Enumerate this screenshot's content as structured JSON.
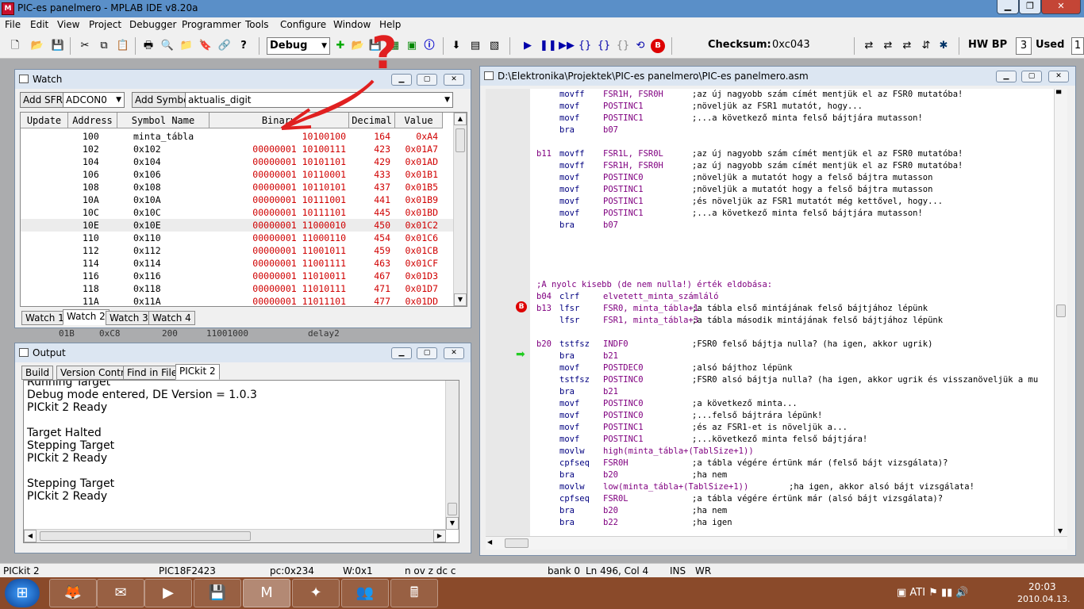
{
  "window": {
    "title": "PIC-es panelmero - MPLAB IDE v8.20a",
    "app_icon": "MPLAB IDE"
  },
  "menu": [
    "File",
    "Edit",
    "View",
    "Project",
    "Debugger",
    "Programmer",
    "Tools",
    "Configure",
    "Window",
    "Help"
  ],
  "toolbar": {
    "config": "Debug",
    "checksum_label": "Checksum:",
    "checksum_value": "0xc043",
    "hwbp_label": "HW BP",
    "hwbp_value": "3",
    "used_label": "Used",
    "used_value": "1"
  },
  "annotation": {
    "question_mark": "?"
  },
  "watch": {
    "title": "Watch",
    "add_sfr": "Add SFR",
    "sfr_value": "ADCON0",
    "add_symbol": "Add Symbol",
    "symbol_value": "aktualis_digit",
    "columns": [
      "Update",
      "Address",
      "Symbol Name",
      "Binary",
      "Decimal",
      "Value"
    ],
    "rows": [
      {
        "addr": "100",
        "sym": "minta_tábla",
        "bin": "10100100",
        "dec": "164",
        "val": "0xA4"
      },
      {
        "addr": "102",
        "sym": "0x102",
        "bin": "00000001 10100111",
        "dec": "423",
        "val": "0x01A7"
      },
      {
        "addr": "104",
        "sym": "0x104",
        "bin": "00000001 10101101",
        "dec": "429",
        "val": "0x01AD"
      },
      {
        "addr": "106",
        "sym": "0x106",
        "bin": "00000001 10110001",
        "dec": "433",
        "val": "0x01B1"
      },
      {
        "addr": "108",
        "sym": "0x108",
        "bin": "00000001 10110101",
        "dec": "437",
        "val": "0x01B5"
      },
      {
        "addr": "10A",
        "sym": "0x10A",
        "bin": "00000001 10111001",
        "dec": "441",
        "val": "0x01B9"
      },
      {
        "addr": "10C",
        "sym": "0x10C",
        "bin": "00000001 10111101",
        "dec": "445",
        "val": "0x01BD"
      },
      {
        "addr": "10E",
        "sym": "0x10E",
        "bin": "00000001 11000010",
        "dec": "450",
        "val": "0x01C2"
      },
      {
        "addr": "110",
        "sym": "0x110",
        "bin": "00000001 11000110",
        "dec": "454",
        "val": "0x01C6"
      },
      {
        "addr": "112",
        "sym": "0x112",
        "bin": "00000001 11001011",
        "dec": "459",
        "val": "0x01CB"
      },
      {
        "addr": "114",
        "sym": "0x114",
        "bin": "00000001 11001111",
        "dec": "463",
        "val": "0x01CF"
      },
      {
        "addr": "116",
        "sym": "0x116",
        "bin": "00000001 11010011",
        "dec": "467",
        "val": "0x01D3"
      },
      {
        "addr": "118",
        "sym": "0x118",
        "bin": "00000001 11010111",
        "dec": "471",
        "val": "0x01D7"
      },
      {
        "addr": "11A",
        "sym": "0x11A",
        "bin": "00000001 11011101",
        "dec": "477",
        "val": "0x01DD"
      }
    ],
    "tabs": [
      "Watch 1",
      "Watch 2",
      "Watch 3",
      "Watch 4"
    ],
    "behind_row": {
      "a": "01B",
      "b": "0xC8",
      "c": "200",
      "d": "11001000",
      "e": "delay2"
    }
  },
  "output": {
    "title": "Output",
    "tabs": [
      "Build",
      "Version Control",
      "Find in Files",
      "PICkit 2"
    ],
    "lines": [
      "Running Target",
      "Debug mode entered, DE Version = 1.0.3",
      "PICkit 2 Ready",
      "",
      "Target Halted",
      "Stepping Target",
      "PICkit 2 Ready",
      "",
      "Stepping Target",
      "PICkit 2 Ready"
    ]
  },
  "editor": {
    "title": "D:\\Elektronika\\Projektek\\PIC-es panelmero\\PIC-es panelmero.asm",
    "lines": [
      {
        "l": "",
        "i": "movff",
        "o": "FSR1H, FSR0H",
        "c": ";az új nagyobb szám címét mentjük el az FSR0 mutatóba!"
      },
      {
        "l": "",
        "i": "movf",
        "o": "POSTINC1",
        "c": ";növeljük az FSR1 mutatót, hogy..."
      },
      {
        "l": "",
        "i": "movf",
        "o": "POSTINC1",
        "c": ";...a következő minta felső bájtjára mutasson!"
      },
      {
        "l": "",
        "i": "bra",
        "o": "b07",
        "c": ""
      },
      {
        "l": "",
        "i": "",
        "o": "",
        "c": ""
      },
      {
        "l": "b11",
        "i": "movff",
        "o": "FSR1L, FSR0L",
        "c": ";az új nagyobb szám címét mentjük el az FSR0 mutatóba!"
      },
      {
        "l": "",
        "i": "movff",
        "o": "FSR1H, FSR0H",
        "c": ";az új nagyobb szám címét mentjük el az FSR0 mutatóba!"
      },
      {
        "l": "",
        "i": "movf",
        "o": "POSTINC0",
        "c": ";növeljük a mutatót hogy a felső bájtra mutasson"
      },
      {
        "l": "",
        "i": "movf",
        "o": "POSTINC1",
        "c": ";növeljük a mutatót hogy a felső bájtra mutasson"
      },
      {
        "l": "",
        "i": "movf",
        "o": "POSTINC1",
        "c": ";és növeljük az FSR1 mutatót még kettővel, hogy..."
      },
      {
        "l": "",
        "i": "movf",
        "o": "POSTINC1",
        "c": ";...a következő minta felső bájtjára mutasson!"
      },
      {
        "l": "",
        "i": "bra",
        "o": "b07",
        "c": ""
      },
      {
        "l": "",
        "i": "",
        "o": "",
        "c": ""
      },
      {
        "l": "",
        "i": "",
        "o": "",
        "c": ""
      },
      {
        "l": "",
        "i": "",
        "o": "",
        "c": ""
      },
      {
        "l": "",
        "i": "",
        "o": "",
        "c": ""
      },
      {
        "l": ";A nyolc kisebb (de nem nulla!) érték eldobása:",
        "i": "",
        "o": "",
        "c": ""
      },
      {
        "l": "b04",
        "i": "clrf",
        "o": "elvetett_minta_számláló",
        "c": ""
      },
      {
        "l": "b13",
        "i": "lfsr",
        "o": "FSR0, minta_tábla+1",
        "c": ";a tábla első mintájának felső bájtjához lépünk"
      },
      {
        "l": "",
        "i": "lfsr",
        "o": "FSR1, minta_tábla+3",
        "c": ";a tábla második mintájának felső bájtjához lépünk"
      },
      {
        "l": "",
        "i": "",
        "o": "",
        "c": ""
      },
      {
        "l": "b20",
        "i": "tstfsz",
        "o": "INDF0",
        "c": ";FSR0 felső bájtja nulla? (ha igen, akkor ugrik)"
      },
      {
        "l": "",
        "i": "bra",
        "o": "b21",
        "c": ""
      },
      {
        "l": "",
        "i": "movf",
        "o": "POSTDEC0",
        "c": ";alsó bájthoz lépünk"
      },
      {
        "l": "",
        "i": "tstfsz",
        "o": "POSTINC0",
        "c": ";FSR0 alsó bájtja nulla? (ha igen, akkor ugrik és visszanöveljük a mu"
      },
      {
        "l": "",
        "i": "bra",
        "o": "b21",
        "c": ""
      },
      {
        "l": "",
        "i": "movf",
        "o": "POSTINC0",
        "c": ";a következő minta..."
      },
      {
        "l": "",
        "i": "movf",
        "o": "POSTINC0",
        "c": ";...felső bájtrára lépünk!"
      },
      {
        "l": "",
        "i": "movf",
        "o": "POSTINC1",
        "c": ";és az FSR1-et is növeljük a..."
      },
      {
        "l": "",
        "i": "movf",
        "o": "POSTINC1",
        "c": ";...következő minta felső bájtjára!"
      },
      {
        "l": "",
        "i": "movlw",
        "o": "high(minta_tábla+(TablSize+1))",
        "c": ""
      },
      {
        "l": "",
        "i": "cpfseq",
        "o": "FSR0H",
        "c": ";a tábla végére értünk már (felső bájt vizsgálata)?"
      },
      {
        "l": "",
        "i": "bra",
        "o": "b20",
        "c": ";ha nem"
      },
      {
        "l": "",
        "i": "movlw",
        "o": "low(minta_tábla+(TablSize+1))",
        "c": ";ha igen, akkor alsó bájt vizsgálata!"
      },
      {
        "l": "",
        "i": "cpfseq",
        "o": "FSR0L",
        "c": ";a tábla végére értünk már (alsó bájt vizsgálata)?"
      },
      {
        "l": "",
        "i": "bra",
        "o": "b20",
        "c": ";ha nem"
      },
      {
        "l": "",
        "i": "bra",
        "o": "b22",
        "c": ";ha igen"
      }
    ]
  },
  "status": {
    "tool": "PICkit 2",
    "device": "PIC18F2423",
    "pc": "pc:0x234",
    "w": "W:0x1",
    "flags": "n ov z dc c",
    "bank": "bank 0",
    "pos": "Ln 496, Col 4",
    "ins": "INS",
    "wr": "WR"
  },
  "taskbar": {
    "time": "20:03",
    "date": "2010.04.13."
  },
  "colors": {
    "accent_red": "#d00000",
    "label": "#800080",
    "instr": "#000080"
  }
}
